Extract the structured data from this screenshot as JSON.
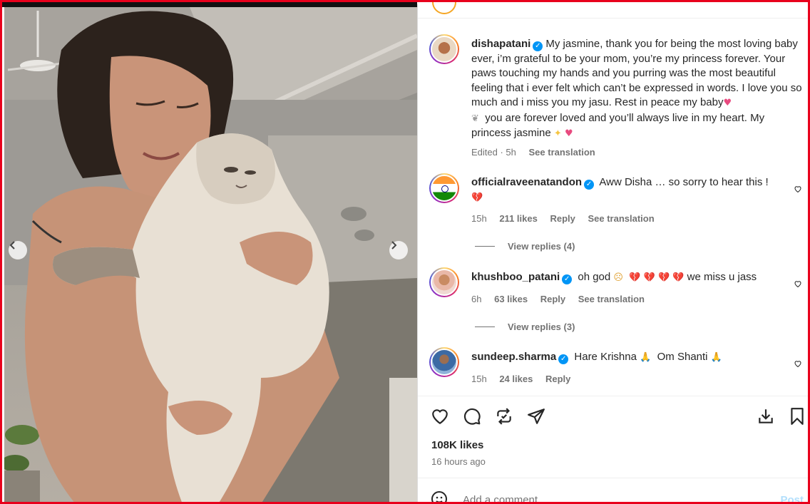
{
  "post": {
    "caption_user": "dishapatani",
    "caption_text": "My jasmine, thank you for being the most loving baby ever, i’m grateful to be your mom, you’re my princess forever. Your paws touching my hands and you purring was the most beautiful feeling that i ever felt which can’t be expressed in words. I love you so much and i miss you my jasu. Rest in peace my baby",
    "caption_text_2": "you are forever loved and you’ll always live in my heart. My princess jasmine",
    "caption_meta_edited": "Edited · 5h",
    "caption_see_translation": "See translation",
    "likes": "108K likes",
    "time_ago": "16 hours ago"
  },
  "comments": [
    {
      "user": "officialraveenatandon",
      "text": "Aww Disha … so sorry to hear this !",
      "time": "15h",
      "likes": "211 likes",
      "reply": "Reply",
      "see_translation": "See translation",
      "view_replies": "View replies (4)"
    },
    {
      "user": "khushboo_patani",
      "text_pre": "oh god",
      "text_post": "we miss u jass",
      "time": "6h",
      "likes": "63 likes",
      "reply": "Reply",
      "see_translation": "See translation",
      "view_replies": "View replies (3)"
    },
    {
      "user": "sundeep.sharma",
      "text_pre": "Hare Krishna",
      "text_post": "Om Shanti",
      "time": "15h",
      "likes": "24 likes",
      "reply": "Reply"
    }
  ],
  "add_comment": {
    "placeholder": "Add a comment…",
    "post_label": "Post"
  },
  "icons": {
    "like": "heart-icon",
    "comment": "comment-icon",
    "share": "repost-icon",
    "send": "send-icon",
    "save": "save-icon",
    "bookmark": "bookmark-icon",
    "emoji": "emoji-icon"
  },
  "colors": {
    "accent_border": "#e8001c",
    "verified": "#0095f6",
    "post_button": "#b2dffc"
  }
}
